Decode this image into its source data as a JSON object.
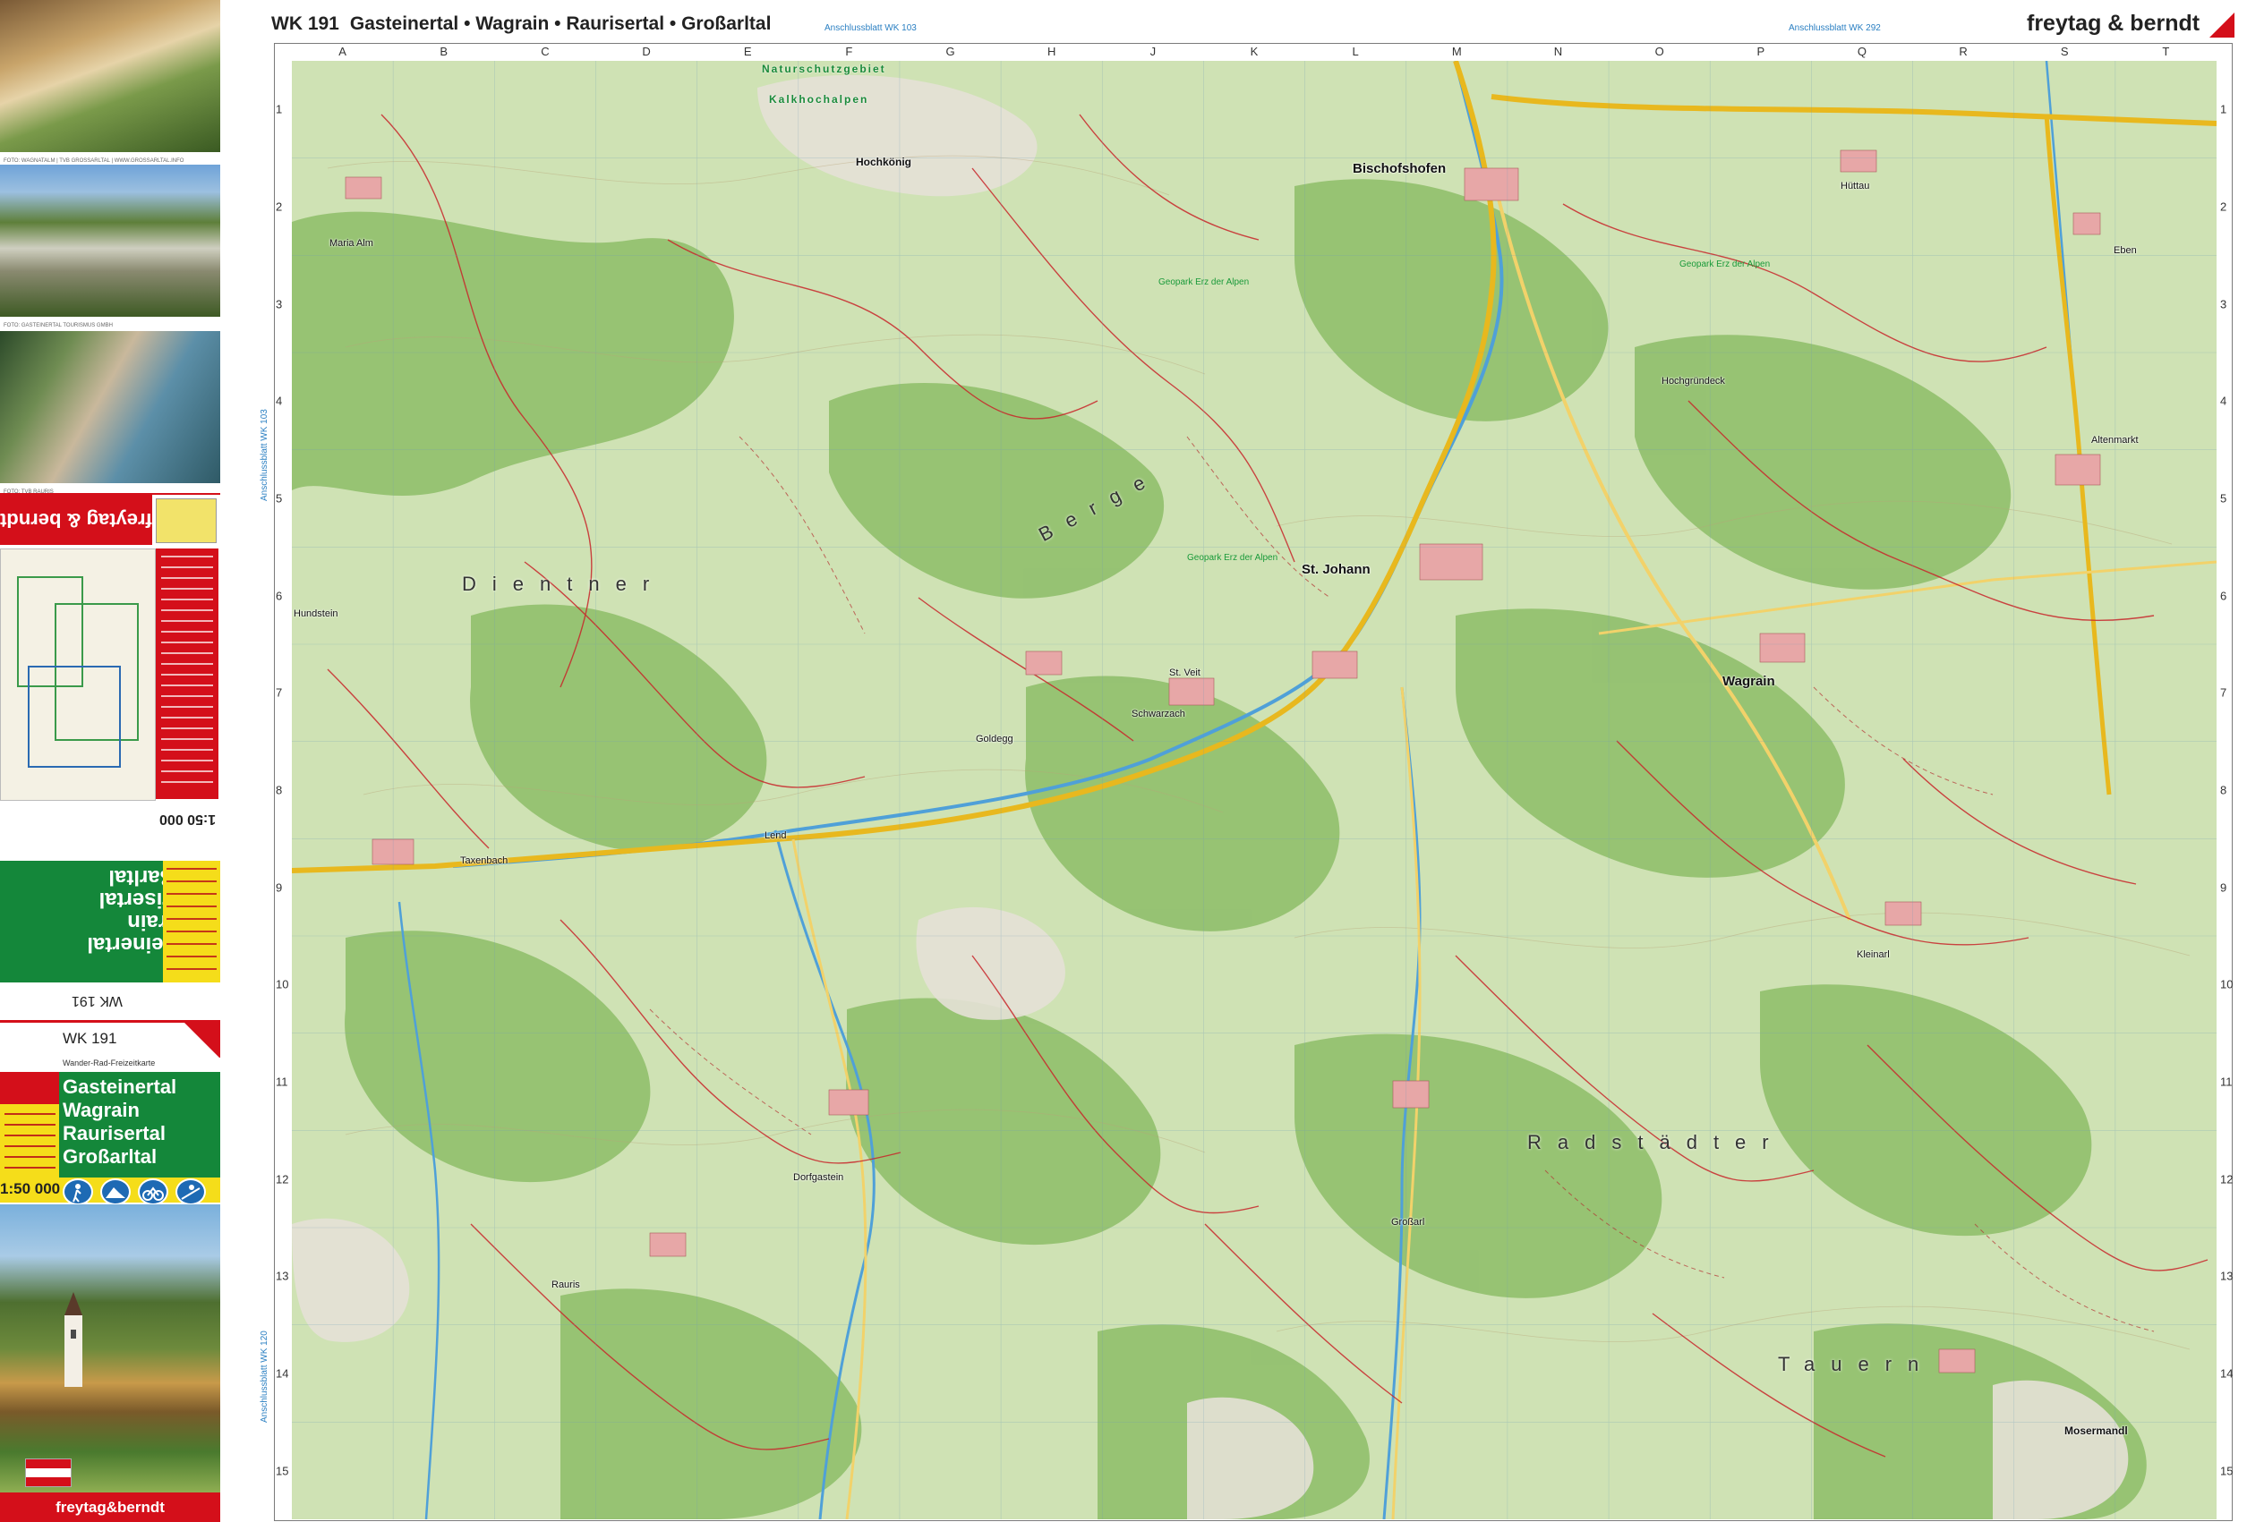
{
  "cover": {
    "photo_credits": [
      "FOTO: WAGNATALM | TVB GROSSARLTAL | WWW.GROSSARLTAL.INFO",
      "FOTO: GASTEINERTAL TOURISMUS GMBH",
      "FOTO: TVB RAURIS"
    ],
    "back": {
      "brand": "freytag & berndt",
      "title": "Gasteinertal\nWagrain\nRaurisertal\nGroßarltal",
      "scale": "1:50 000",
      "wk": "WK 191"
    },
    "front": {
      "wk": "WK 191",
      "subtitle": "Wander-Rad-Freizeitkarte",
      "title": "Gasteinertal\nWagrain\nRaurisertal\nGroßarltal",
      "scale": "1:50 000",
      "bottom_brand": "freytag&berndt",
      "activity_icons": [
        "hiking-icon",
        "mountain-bike-icon",
        "cycling-icon",
        "ski-touring-icon"
      ]
    }
  },
  "sheet": {
    "wk": "WK 191",
    "title": "Gasteinertal • Wagrain • Raurisertal • Großarltal",
    "adjacent_north_left": "Anschlussblatt WK 103",
    "adjacent_north_right": "Anschlussblatt WK 292",
    "adjacent_west_upper": "Anschlussblatt WK 103",
    "adjacent_west_lower": "Anschlussblatt WK 120",
    "brand": "freytag & berndt"
  },
  "grid": {
    "columns": [
      "A",
      "B",
      "C",
      "D",
      "E",
      "F",
      "G",
      "H",
      "J",
      "K",
      "L",
      "M",
      "N",
      "O",
      "P",
      "Q",
      "R",
      "S",
      "T"
    ],
    "rows": [
      "1",
      "2",
      "3",
      "4",
      "5",
      "6",
      "7",
      "8",
      "9",
      "10",
      "11",
      "12",
      "13",
      "14",
      "15"
    ]
  },
  "map": {
    "towns": [
      "Bischofshofen",
      "St. Johann",
      "Wagrain",
      "Schwarzach",
      "St. Veit",
      "Großarl",
      "Taxenbach",
      "Dorfgastein",
      "Hochkönig",
      "Altenmarkt",
      "Eben",
      "Hüttau",
      "Goldegg",
      "Kleinarl",
      "Maria Alm",
      "Hundstein",
      "Rauris",
      "Mosermandl",
      "Hochgründeck",
      "Lend"
    ],
    "regions": [
      "Dientner",
      "Berge",
      "Radstädter",
      "Tauern"
    ],
    "nature_reserve": [
      "Naturschutzgebiet",
      "Kalkhochalpen"
    ],
    "geoparks": [
      "Geopark Erz der Alpen",
      "Geopark Erz der Alpen",
      "Geopark Erz der Alpen"
    ]
  },
  "colors": {
    "brand_red": "#d40f1a",
    "cover_green": "#14873a",
    "cover_yellow": "#f5dd1a",
    "forest": "#7fb45c",
    "meadow": "#cfe2b4",
    "rock": "#e3e0d6",
    "river": "#5aa6d8",
    "trail": "#c8262a"
  }
}
